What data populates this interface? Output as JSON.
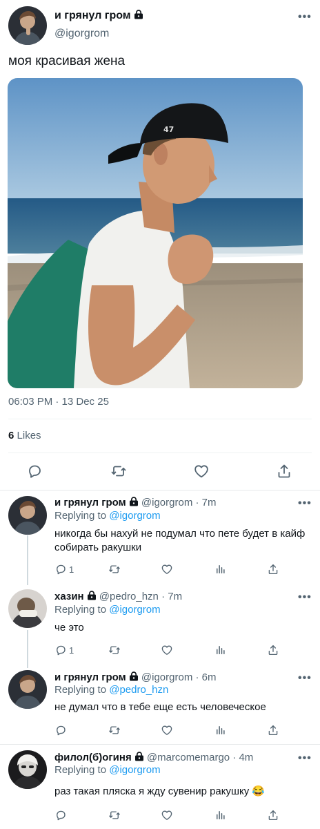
{
  "main_tweet": {
    "author_name": "и грянул гром",
    "author_handle": "@igorgrom",
    "text": "моя красивая жена",
    "timestamp": "06:03 PM · 13 Dec 25",
    "likes_count": "6",
    "likes_label": "Likes",
    "icons": [
      "lock-icon",
      "more-icon",
      "reply-icon",
      "retweet-icon",
      "like-icon",
      "share-icon"
    ]
  },
  "replies": [
    {
      "author_name": "и грянул гром",
      "handle_time": "@igorgrom · 7m",
      "replying_prefix": "Replying to",
      "replying_to": "@igorgrom",
      "text": "никогда бы нахуй не подумал что пете будет в кайф собирать ракушки",
      "reply_count": "1"
    },
    {
      "author_name": "хазин",
      "handle_time": "@pedro_hzn · 7m",
      "replying_prefix": "Replying to",
      "replying_to": "@igorgrom",
      "text": "че это",
      "reply_count": "1"
    },
    {
      "author_name": "и грянул гром",
      "handle_time": "@igorgrom · 6m",
      "replying_prefix": "Replying to",
      "replying_to": "@pedro_hzn",
      "text": "не думал что в тебе еще есть человеческое",
      "reply_count": ""
    },
    {
      "author_name": "филол(б)огиня",
      "handle_time": "@marcomemargo · 4m",
      "replying_prefix": "Replying to",
      "replying_to": "@igorgrom",
      "text": "раз такая пляска я жду сувенир ракушку 😂",
      "reply_count": ""
    }
  ],
  "colors": {
    "link": "#1d9bf0",
    "muted": "#536471",
    "text": "#0f1419"
  }
}
